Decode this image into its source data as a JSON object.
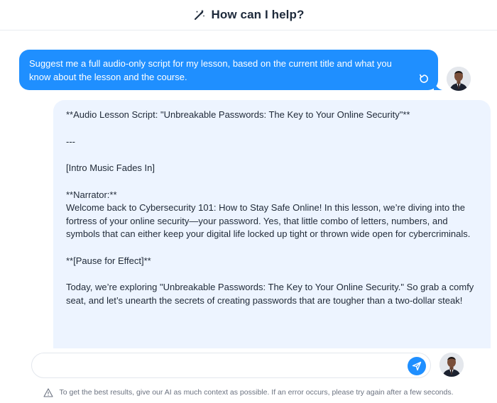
{
  "header": {
    "title": "How can I help?",
    "icon": "magic-wand-icon"
  },
  "conversation": {
    "user_message": "Suggest me a full audio-only script for my lesson, based on the current title and what you know about the lesson and the course.",
    "ai_paragraphs": [
      "**Audio Lesson Script: \"Unbreakable Passwords: The Key to Your Online Security\"**",
      "---",
      "[Intro Music Fades In]",
      "**Narrator:**",
      "Welcome back to Cybersecurity 101: How to Stay Safe Online! In this lesson, we’re diving into the fortress of your online security—your password. Yes, that little combo of letters, numbers, and symbols that can either keep your digital life locked up tight or thrown wide open for cybercriminals.",
      "**[Pause for Effect]**",
      "Today, we’re exploring \"Unbreakable Passwords: The Key to Your Online Security.\" So grab a comfy seat, and let’s unearth the secrets of creating passwords that are tougher than a two-dollar steak!"
    ]
  },
  "composer": {
    "value": "",
    "placeholder": ""
  },
  "footer": {
    "disclaimer": "To get the best results, give our AI as much context as possible. If an error occurs, please try again after a few seconds."
  },
  "colors": {
    "accent": "#1f8fff",
    "ai_bubble": "#edf4ff"
  }
}
